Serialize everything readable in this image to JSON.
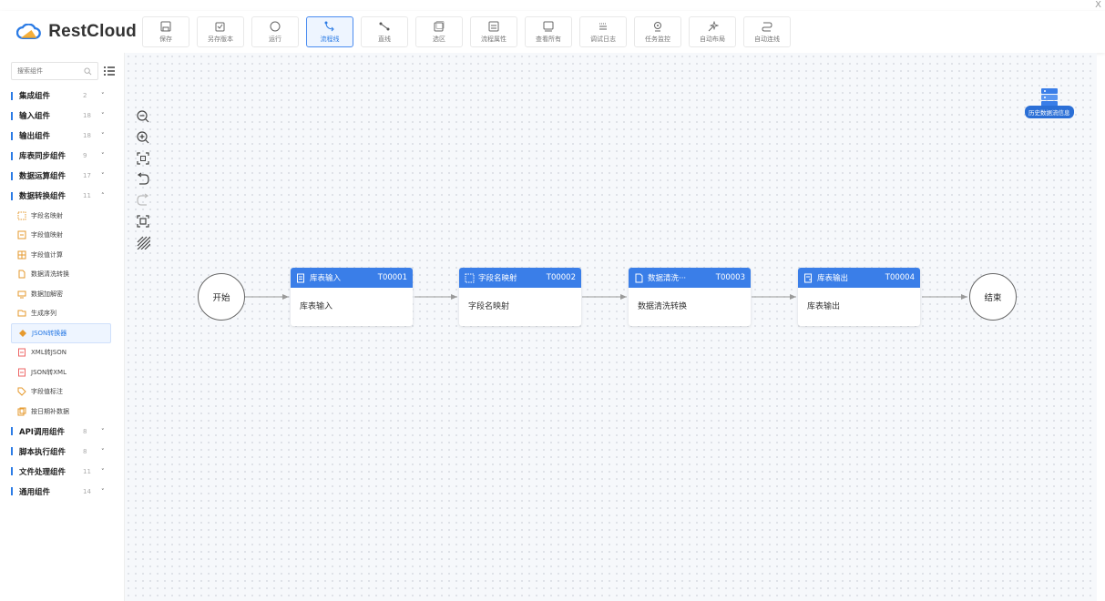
{
  "window": {
    "close_label": "X"
  },
  "brand": {
    "name": "RestCloud",
    "accent": "#2b7be5"
  },
  "toolbar": {
    "tools": [
      {
        "label": "保存",
        "icon": "save-icon"
      },
      {
        "label": "另存版本",
        "icon": "save-version-icon"
      },
      {
        "label": "运行",
        "icon": "run-icon"
      },
      {
        "label": "流程线",
        "icon": "flow-line-icon",
        "active": true
      },
      {
        "label": "直线",
        "icon": "straight-line-icon"
      },
      {
        "label": "选区",
        "icon": "select-area-icon"
      },
      {
        "label": "流程属性",
        "icon": "flow-properties-icon"
      },
      {
        "label": "查看所有",
        "icon": "view-all-icon"
      },
      {
        "label": "调试日志",
        "icon": "debug-log-icon"
      },
      {
        "label": "任务监控",
        "icon": "task-monitor-icon"
      },
      {
        "label": "自动布局",
        "icon": "auto-layout-icon"
      },
      {
        "label": "自动连线",
        "icon": "auto-connect-icon"
      }
    ]
  },
  "sidebar": {
    "search_placeholder": "搜索组件",
    "groups": [
      {
        "name": "集成组件",
        "count": "2",
        "chevron": "˅"
      },
      {
        "name": "输入组件",
        "count": "18",
        "chevron": "˅"
      },
      {
        "name": "输出组件",
        "count": "18",
        "chevron": "˅"
      },
      {
        "name": "库表同步组件",
        "count": "9",
        "chevron": "˅"
      },
      {
        "name": "数据运算组件",
        "count": "17",
        "chevron": "˅"
      },
      {
        "name": "数据转换组件",
        "count": "11",
        "chevron": "˄"
      },
      {
        "name": "API调用组件",
        "count": "8",
        "chevron": "˅"
      },
      {
        "name": "脚本执行组件",
        "count": "8",
        "chevron": "˅"
      },
      {
        "name": "文件处理组件",
        "count": "11",
        "chevron": "˅"
      },
      {
        "name": "通用组件",
        "count": "14",
        "chevron": "˅"
      }
    ],
    "transform_items": [
      {
        "name": "字段名映射",
        "icon": "field-map-icon"
      },
      {
        "name": "字段值映射",
        "icon": "value-map-icon"
      },
      {
        "name": "字段值计算",
        "icon": "calculator-icon"
      },
      {
        "name": "数据清洗转换",
        "icon": "data-clean-icon"
      },
      {
        "name": "数据加解密",
        "icon": "encrypt-icon"
      },
      {
        "name": "生成序列",
        "icon": "sequence-icon"
      },
      {
        "name": "JSON转换器",
        "icon": "json-converter-icon",
        "active": true
      },
      {
        "name": "XML转JSON",
        "icon": "xml-to-json-icon"
      },
      {
        "name": "JSON转XML",
        "icon": "json-to-xml-icon"
      },
      {
        "name": "字段值标注",
        "icon": "tag-icon"
      },
      {
        "name": "按日期补数据",
        "icon": "date-fill-icon"
      }
    ]
  },
  "canvas": {
    "history_label": "历史数据流信息",
    "start_label": "开始",
    "end_label": "结束",
    "nodes": [
      {
        "title": "库表输入",
        "code": "T00001",
        "body": "库表输入",
        "icon": "table-input-icon"
      },
      {
        "title": "字段名映射",
        "code": "T00002",
        "body": "字段名映射",
        "icon": "field-map-icon"
      },
      {
        "title": "数据清洗···",
        "code": "T00003",
        "body": "数据清洗转换",
        "icon": "data-clean-icon"
      },
      {
        "title": "库表输出",
        "code": "T00004",
        "body": "库表输出",
        "icon": "table-output-icon"
      }
    ],
    "controls": [
      "zoom-out-icon",
      "zoom-in-icon",
      "fit-view-icon",
      "undo-icon",
      "redo-icon",
      "actual-size-icon",
      "grid-toggle-icon"
    ]
  }
}
